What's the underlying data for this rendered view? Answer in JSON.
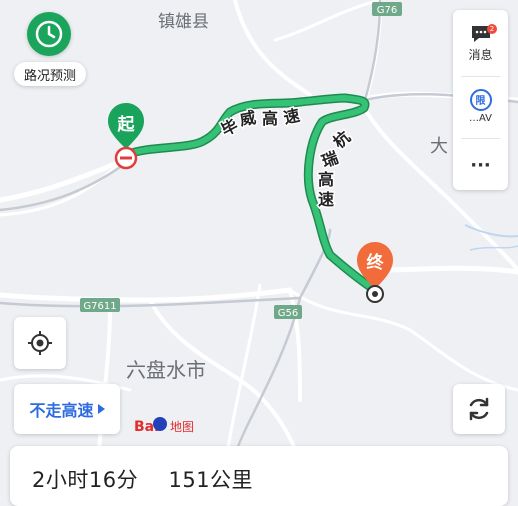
{
  "map": {
    "places": {
      "zhenxiong": "镇雄县",
      "liupanshui": "六盘水市",
      "da": "大"
    },
    "roads": {
      "g76": "G76",
      "g7611": "G7611",
      "g56": "G56"
    },
    "route": {
      "segment1": [
        "毕",
        "威",
        "高",
        "速"
      ],
      "segment2": [
        "杭",
        "瑞",
        "高",
        "速"
      ],
      "color": "#36c276",
      "outline": "#1f8a4f"
    },
    "markers": {
      "start": "起",
      "end": "终",
      "start_color": "#1aa35b",
      "end_color": "#f26b3a"
    },
    "logo": {
      "text1": "Bai",
      "text2": "地图",
      "color_red": "#e32d2d",
      "color_blue": "#2440b8"
    }
  },
  "buttons": {
    "traffic_forecast": {
      "label": "路况预测",
      "icon": "clock-icon",
      "color": "#1ba55c"
    },
    "messages": {
      "label": "消息",
      "badge": "2",
      "icon": "chat-icon"
    },
    "restriction": {
      "label": "限",
      "sublabel": "…AV",
      "icon": "restriction-icon"
    },
    "more": {
      "label": "···",
      "icon": "more-icon"
    },
    "locate": {
      "icon": "locate-icon"
    },
    "no_highway": {
      "label": "不走高速",
      "color": "#2f6be0"
    },
    "refresh": {
      "icon": "refresh-icon"
    }
  },
  "summary": {
    "duration": "2小时16分",
    "distance": "151公里"
  }
}
